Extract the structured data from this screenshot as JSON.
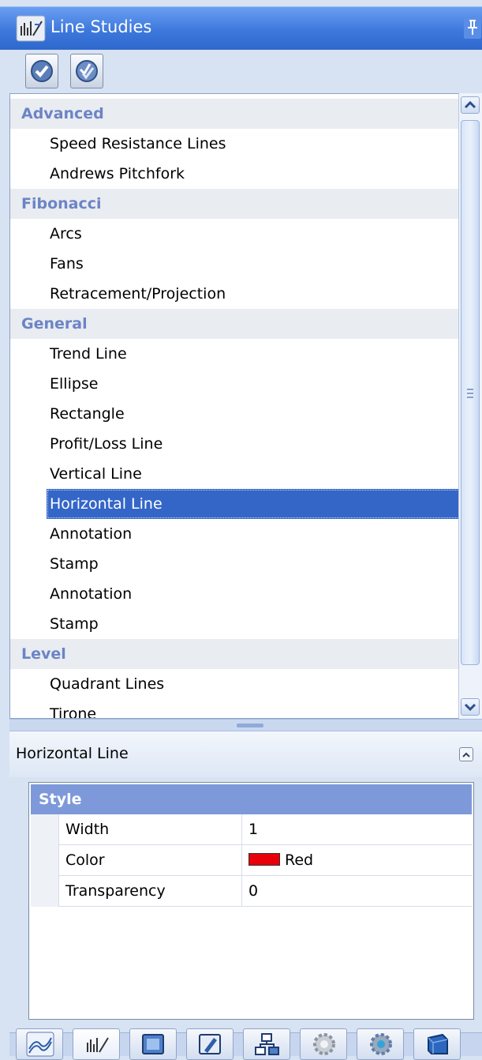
{
  "window": {
    "title": "Line Studies"
  },
  "toolbar": {
    "buttons": [
      {
        "icon": "check-circle-icon"
      },
      {
        "icon": "check-all-icon"
      }
    ]
  },
  "groups": [
    {
      "label": "Advanced",
      "items": [
        "Speed Resistance Lines",
        "Andrews Pitchfork"
      ]
    },
    {
      "label": "Fibonacci",
      "items": [
        "Arcs",
        "Fans",
        "Retracement/Projection"
      ]
    },
    {
      "label": "General",
      "items": [
        "Trend Line",
        "Ellipse",
        "Rectangle",
        "Profit/Loss Line",
        "Vertical Line",
        "Horizontal Line",
        "Annotation",
        "Stamp",
        "Annotation",
        "Stamp"
      ]
    },
    {
      "label": "Level",
      "items": [
        "Quadrant Lines",
        "Tirone"
      ]
    }
  ],
  "selected_item": "Horizontal Line",
  "properties": {
    "title": "Horizontal Line",
    "category": "Style",
    "rows": [
      {
        "name": "Width",
        "value": "1"
      },
      {
        "name": "Color",
        "value": "Red",
        "swatch": "#e8000b"
      },
      {
        "name": "Transparency",
        "value": "0"
      }
    ]
  },
  "bottom_tabs": [
    {
      "icon": "wave-lines-icon"
    },
    {
      "icon": "line-studies-icon",
      "active": true
    },
    {
      "icon": "window-icon"
    },
    {
      "icon": "edit-window-icon"
    },
    {
      "icon": "hierarchy-icon"
    },
    {
      "icon": "gear-icon"
    },
    {
      "icon": "color-gear-icon"
    },
    {
      "icon": "cube-icon"
    }
  ],
  "colors": {
    "accent": "#3466c8",
    "group_text": "#6c84c5",
    "category_bg": "#7d99d9"
  }
}
